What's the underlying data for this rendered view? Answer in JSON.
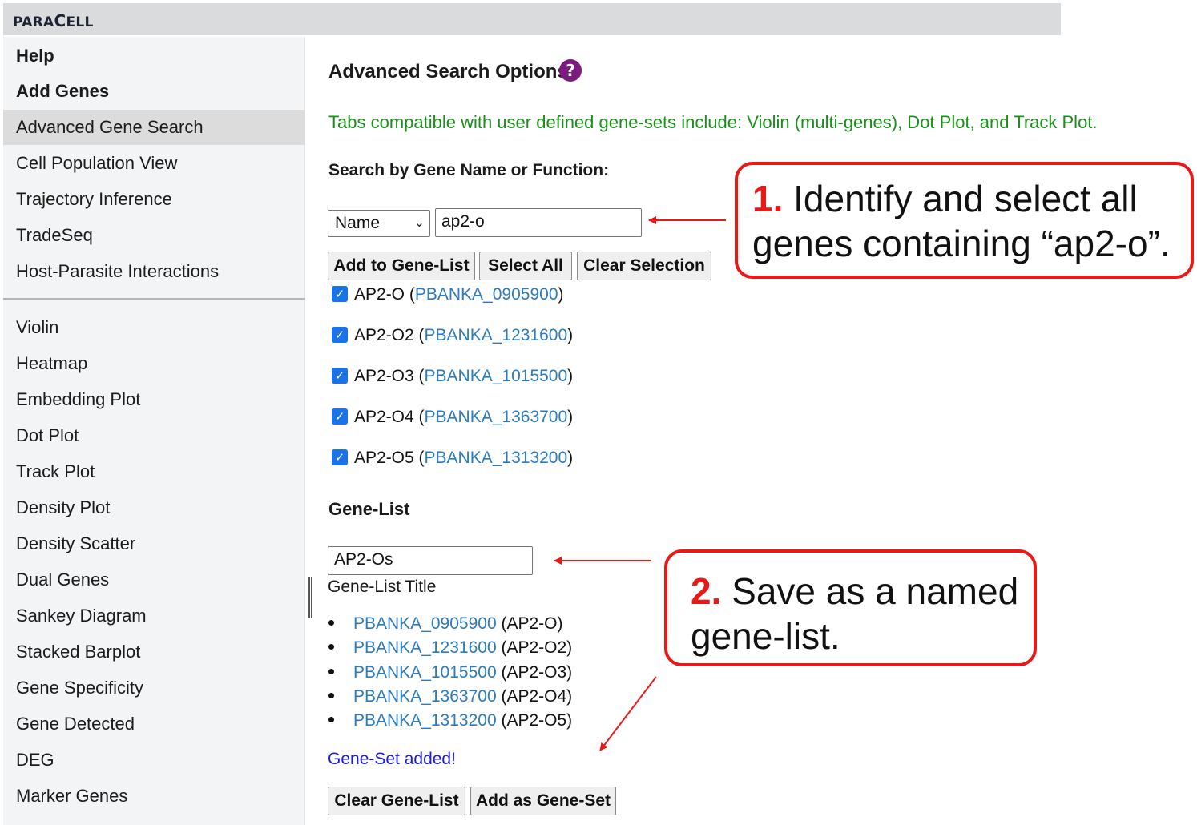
{
  "brand": {
    "part1": "PARA",
    "cap": "C",
    "part2": "ELL"
  },
  "sidebar": {
    "items": [
      {
        "label": "Help"
      },
      {
        "label": "Add Genes"
      },
      {
        "label": "Advanced Gene Search"
      },
      {
        "label": "Cell Population View"
      },
      {
        "label": "Trajectory Inference"
      },
      {
        "label": "TradeSeq"
      },
      {
        "label": "Host-Parasite Interactions"
      },
      {
        "label": "Violin"
      },
      {
        "label": "Heatmap"
      },
      {
        "label": "Embedding Plot"
      },
      {
        "label": "Dot Plot"
      },
      {
        "label": "Track Plot"
      },
      {
        "label": "Density Plot"
      },
      {
        "label": "Density Scatter"
      },
      {
        "label": "Dual Genes"
      },
      {
        "label": "Sankey Diagram"
      },
      {
        "label": "Stacked Barplot"
      },
      {
        "label": "Gene Specificity"
      },
      {
        "label": "Gene Detected"
      },
      {
        "label": "DEG"
      },
      {
        "label": "Marker Genes"
      }
    ]
  },
  "main": {
    "title": "Advanced Search Options",
    "help_icon": "?",
    "compat_note": "Tabs compatible with user defined gene-sets include: Violin (multi-genes), Dot Plot, and Track Plot.",
    "search_label": "Search by Gene Name or Function:",
    "search_mode": "Name",
    "search_value": "ap2-o",
    "buttons": {
      "add_to_list": "Add to Gene-List",
      "select_all": "Select All",
      "clear_selection": "Clear Selection"
    },
    "results": [
      {
        "name": "AP2-O",
        "id": "PBANKA_0905900",
        "open": " (",
        "close": ")"
      },
      {
        "name": "AP2-O2",
        "id": "PBANKA_1231600",
        "open": " (",
        "close": ")"
      },
      {
        "name": "AP2-O3",
        "id": "PBANKA_1015500",
        "open": " (",
        "close": ")"
      },
      {
        "name": "AP2-O4",
        "id": "PBANKA_1363700",
        "open": " (",
        "close": ")"
      },
      {
        "name": "AP2-O5",
        "id": "PBANKA_1313200",
        "open": " (",
        "close": ")"
      }
    ],
    "genelist_label": "Gene-List",
    "genelist_title_value": "AP2-Os",
    "genelist_title_caption": "Gene-List Title",
    "genelist": [
      {
        "id": "PBANKA_0905900",
        "name": " (AP2-O)"
      },
      {
        "id": "PBANKA_1231600",
        "name": " (AP2-O2)"
      },
      {
        "id": "PBANKA_1015500",
        "name": " (AP2-O3)"
      },
      {
        "id": "PBANKA_1363700",
        "name": " (AP2-O4)"
      },
      {
        "id": "PBANKA_1313200",
        "name": " (AP2-O5)"
      }
    ],
    "added_msg": "Gene-Set added!",
    "buttons2": {
      "clear_list": "Clear Gene-List",
      "add_gene_set": "Add as Gene-Set"
    }
  },
  "callouts": {
    "c1_num": "1.",
    "c1_line1": " Identify and select all",
    "c1_line2": "genes containing “ap2-o”.",
    "c2_num": "2.",
    "c2_line1": " Save as a named",
    "c2_line2": "gene-list."
  },
  "colors": {
    "callout_red": "#e81919",
    "link_blue": "#2b7bc0",
    "note_green": "#1a8f1a",
    "help_purple": "#7d1a7d"
  }
}
